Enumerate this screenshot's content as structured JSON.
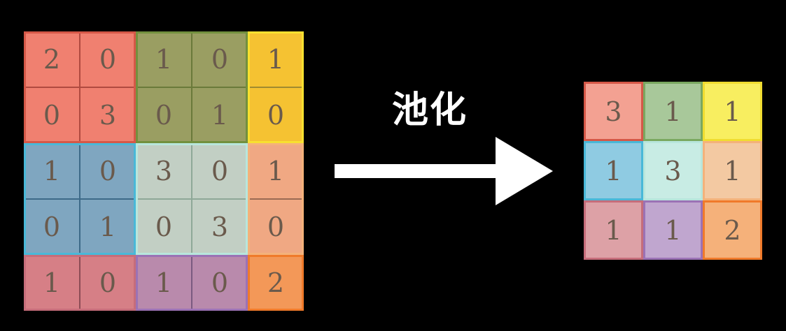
{
  "diagram": {
    "operation_label": "池化",
    "input": {
      "rows": 5,
      "cols": 5,
      "values": [
        [
          "2",
          "0",
          "1",
          "0",
          "1"
        ],
        [
          "0",
          "3",
          "0",
          "1",
          "0"
        ],
        [
          "1",
          "0",
          "3",
          "0",
          "1"
        ],
        [
          "0",
          "1",
          "0",
          "3",
          "0"
        ],
        [
          "1",
          "0",
          "1",
          "0",
          "2"
        ]
      ],
      "regions": [
        {
          "name": "region-top-left",
          "r": 0,
          "c": 0,
          "h": 2,
          "w": 2,
          "fill": "#f08070",
          "border": "#d55848",
          "line": "#b04a40"
        },
        {
          "name": "region-top-middle",
          "r": 0,
          "c": 2,
          "h": 2,
          "w": 2,
          "fill": "#9a9e62",
          "border": "#72903e",
          "line": "#6a7a3a"
        },
        {
          "name": "region-top-right",
          "r": 0,
          "c": 4,
          "h": 2,
          "w": 1,
          "fill": "#f5c232",
          "border": "#f8e030",
          "line": "#a08a30"
        },
        {
          "name": "region-middle-left",
          "r": 2,
          "c": 0,
          "h": 2,
          "w": 2,
          "fill": "#7fa6c0",
          "border": "#49b8d8",
          "line": "#3d6a88"
        },
        {
          "name": "region-center",
          "r": 2,
          "c": 2,
          "h": 2,
          "w": 2,
          "fill": "#c2cfc4",
          "border": "#b8e6dc",
          "line": "#8ea898"
        },
        {
          "name": "region-middle-right",
          "r": 2,
          "c": 4,
          "h": 2,
          "w": 1,
          "fill": "#f0a883",
          "border": "#f4b27a",
          "line": "#9a6a52"
        },
        {
          "name": "region-bottom-left",
          "r": 4,
          "c": 0,
          "h": 1,
          "w": 2,
          "fill": "#d67f86",
          "border": "#c66d7a",
          "line": "#8c4c56"
        },
        {
          "name": "region-bottom-middle",
          "r": 4,
          "c": 2,
          "h": 1,
          "w": 2,
          "fill": "#b98aac",
          "border": "#9b72b5",
          "line": "#7a5a80"
        },
        {
          "name": "region-bottom-right",
          "r": 4,
          "c": 4,
          "h": 1,
          "w": 1,
          "fill": "#f39858",
          "border": "#f07a2a",
          "line": "#b06030"
        }
      ]
    },
    "output": {
      "rows": 3,
      "cols": 3,
      "values": [
        [
          "3",
          "1",
          "1"
        ],
        [
          "1",
          "3",
          "1"
        ],
        [
          "1",
          "1",
          "2"
        ]
      ],
      "cells": [
        [
          {
            "fill": "#f3a192",
            "border": "#d55848"
          },
          {
            "fill": "#a8c89a",
            "border": "#7aa860"
          },
          {
            "fill": "#f8ee60",
            "border": "#f0dc30"
          }
        ],
        [
          {
            "fill": "#8fcbe2",
            "border": "#49b8d8"
          },
          {
            "fill": "#c8ece4",
            "border": "#b8e6dc"
          },
          {
            "fill": "#f3c9a2",
            "border": "#f4b27a"
          }
        ],
        [
          {
            "fill": "#dda1a6",
            "border": "#c66d7a"
          },
          {
            "fill": "#c0a6cf",
            "border": "#9b72b5"
          },
          {
            "fill": "#f5b17a",
            "border": "#f07a2a"
          }
        ]
      ]
    },
    "colors": {
      "background": "#000000",
      "arrow": "#ffffff",
      "digit": "#6a5a4c"
    }
  }
}
